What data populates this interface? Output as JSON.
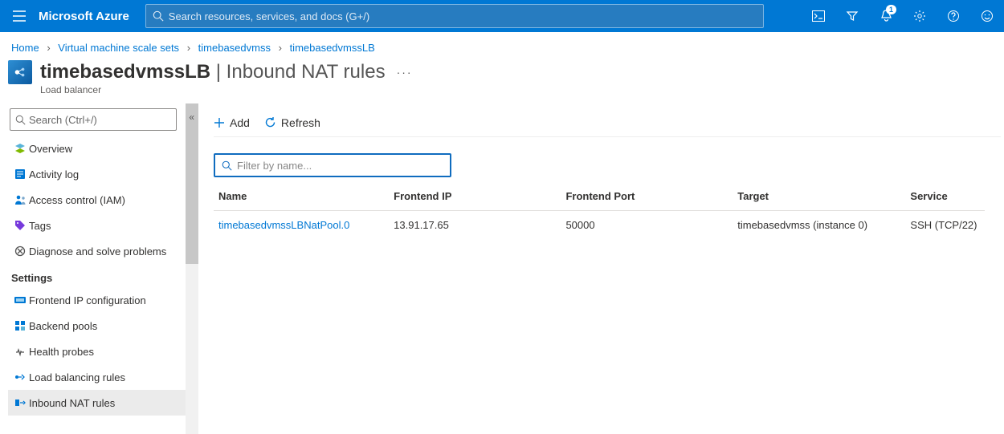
{
  "topbar": {
    "brand": "Microsoft Azure",
    "search_placeholder": "Search resources, services, and docs (G+/)",
    "notification_badge": "1"
  },
  "breadcrumbs": {
    "items": [
      "Home",
      "Virtual machine scale sets",
      "timebasedvmss",
      "timebasedvmssLB"
    ]
  },
  "page": {
    "title_resource": "timebasedvmssLB",
    "title_section": "Inbound NAT rules",
    "subtitle": "Load balancer"
  },
  "side_search_placeholder": "Search (Ctrl+/)",
  "side_menu": {
    "top": [
      {
        "label": "Overview",
        "icon": "overview"
      },
      {
        "label": "Activity log",
        "icon": "activity"
      },
      {
        "label": "Access control (IAM)",
        "icon": "iam"
      },
      {
        "label": "Tags",
        "icon": "tags"
      },
      {
        "label": "Diagnose and solve problems",
        "icon": "diagnose"
      }
    ],
    "settings_heading": "Settings",
    "settings": [
      {
        "label": "Frontend IP configuration",
        "icon": "frontend"
      },
      {
        "label": "Backend pools",
        "icon": "backend"
      },
      {
        "label": "Health probes",
        "icon": "probes"
      },
      {
        "label": "Load balancing rules",
        "icon": "lbrules"
      },
      {
        "label": "Inbound NAT rules",
        "icon": "nat",
        "selected": true
      }
    ]
  },
  "toolbar": {
    "add_label": "Add",
    "refresh_label": "Refresh"
  },
  "filter_placeholder": "Filter by name...",
  "table": {
    "headers": {
      "name": "Name",
      "frontend_ip": "Frontend IP",
      "frontend_port": "Frontend Port",
      "target": "Target",
      "service": "Service"
    },
    "rows": [
      {
        "name": "timebasedvmssLBNatPool.0",
        "frontend_ip": "13.91.17.65",
        "frontend_port": "50000",
        "target": "timebasedvmss (instance 0)",
        "service": "SSH (TCP/22)"
      }
    ]
  }
}
